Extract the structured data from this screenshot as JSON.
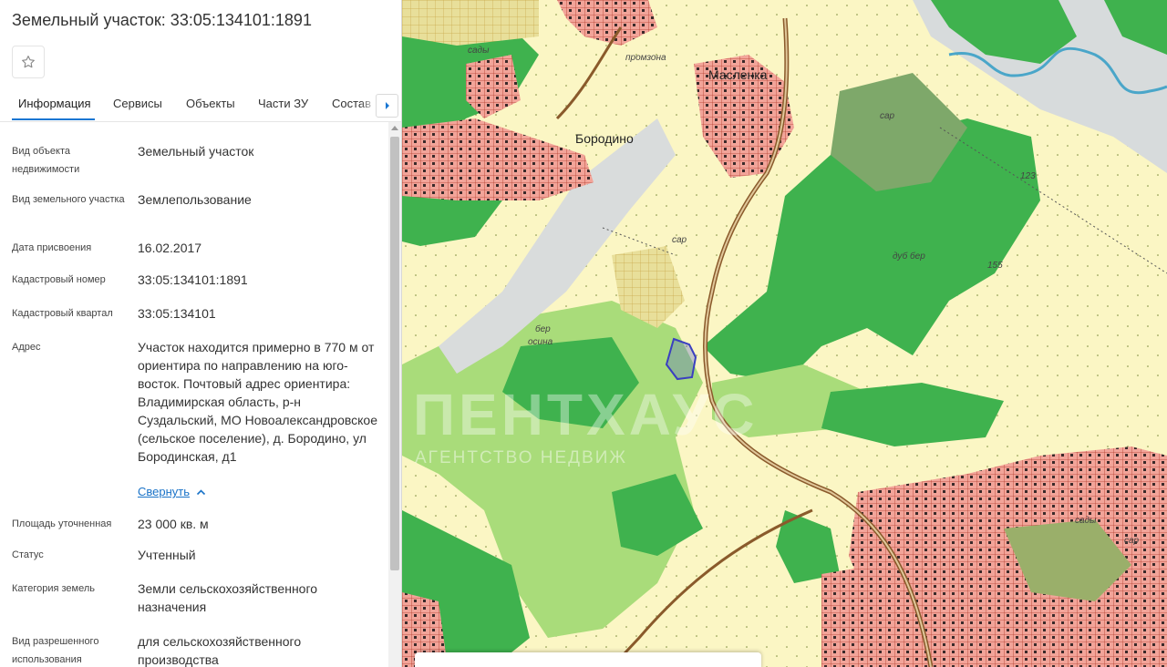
{
  "panel": {
    "title": "Земельный участок: 33:05:134101:1891",
    "tabs": [
      "Информация",
      "Сервисы",
      "Объекты",
      "Части ЗУ",
      "Состав"
    ],
    "collapse_label": "Свернуть",
    "fields": [
      {
        "label": "Вид объекта недвижимости",
        "value": "Земельный участок"
      },
      {
        "label": "Вид земельного участка",
        "value": "Землепользование"
      },
      {
        "label": "Дата присвоения",
        "value": "16.02.2017"
      },
      {
        "label": "Кадастровый номер",
        "value": "33:05:134101:1891"
      },
      {
        "label": "Кадастровый квартал",
        "value": "33:05:134101"
      },
      {
        "label": "Адрес",
        "value": "Участок находится примерно в 770 м от ориентира по направлению на юго-восток. Почтовый адрес ориентира: Владимирская область, р-н Суздальский, МО Новоалександровское (сельское поселение), д. Бородино, ул Бородинская, д1"
      },
      {
        "label": "Площадь уточненная",
        "value": "23 000 кв. м"
      },
      {
        "label": "Статус",
        "value": "Учтенный"
      },
      {
        "label": "Категория земель",
        "value": "Земли сельскохозяйственного назначения"
      },
      {
        "label": "Вид разрешенного использования",
        "value": "для сельскохозяйственного производства"
      }
    ]
  },
  "map": {
    "labels": {
      "maslenka": "Масленка",
      "borodino": "Бородино",
      "promzona": "промзона",
      "sady_top": "сады",
      "sar_1": "сар",
      "sar_2": "сар",
      "sar_3": "сар",
      "sady_right": "сады",
      "dub": "дуб бер",
      "n123": "123",
      "n155": "155",
      "ber": "бер",
      "osina": "осина"
    },
    "watermark": {
      "main": "ПЕНТХАУС",
      "sub": "АГЕНТСТВО НЕДВИЖ"
    }
  },
  "icons": {
    "favorite": "star-outline-icon",
    "tab_scroll": "chevron-right-icon",
    "collapse": "chevron-up-icon"
  },
  "colors": {
    "accent": "#1976d2",
    "link": "#1a73c8",
    "forest": "#3fb24e",
    "light_forest": "#a9dc7a",
    "field": "#fbf6c4",
    "settlement": "#f2a499",
    "parcel_outline": "#3a3fc0",
    "road": "#8a5a2b"
  }
}
